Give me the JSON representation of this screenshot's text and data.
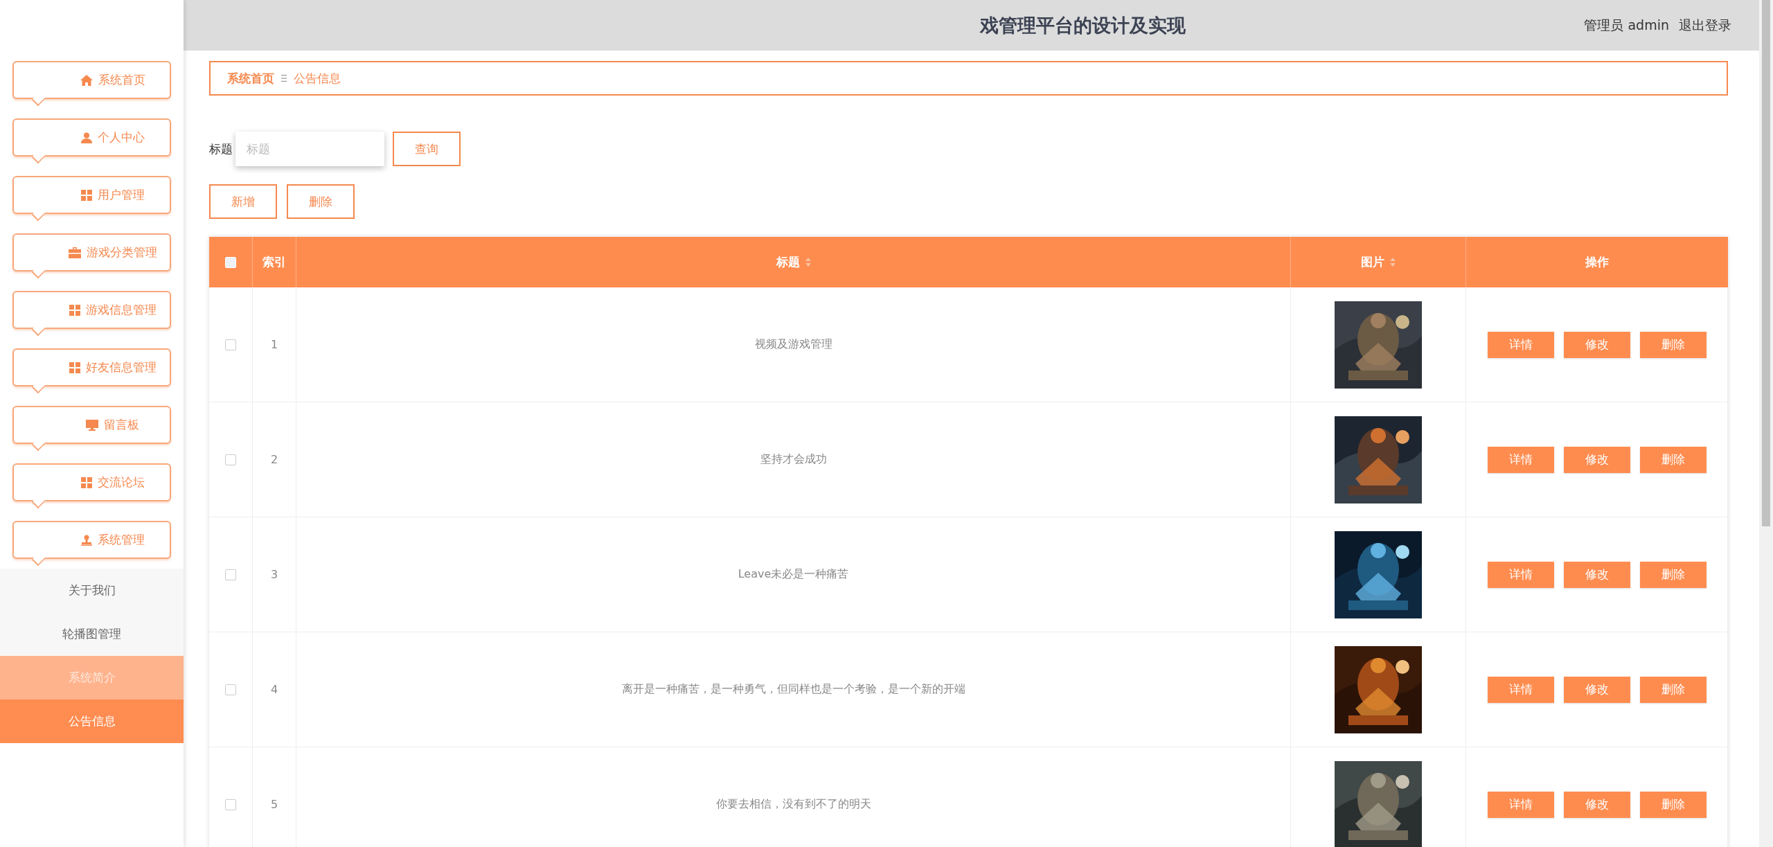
{
  "header": {
    "title": "戏管理平台的设计及实现",
    "user_label": "管理员 admin",
    "logout": "退出登录"
  },
  "sidebar": {
    "items": [
      {
        "label": "系统首页",
        "kind": "home"
      },
      {
        "label": "个人中心",
        "kind": "user"
      },
      {
        "label": "用户管理",
        "kind": "grid"
      },
      {
        "label": "游戏分类管理",
        "kind": "briefcase"
      },
      {
        "label": "游戏信息管理",
        "kind": "grid"
      },
      {
        "label": "好友信息管理",
        "kind": "grid"
      },
      {
        "label": "留言板",
        "kind": "monitor"
      },
      {
        "label": "交流论坛",
        "kind": "grid"
      },
      {
        "label": "系统管理",
        "kind": "stamp"
      }
    ],
    "submenu": [
      {
        "label": "关于我们",
        "selected": false,
        "hovered": false
      },
      {
        "label": "轮播图管理",
        "selected": false,
        "hovered": false
      },
      {
        "label": "系统简介",
        "selected": false,
        "hovered": true
      },
      {
        "label": "公告信息",
        "selected": true,
        "hovered": false
      }
    ]
  },
  "breadcrumb": [
    "系统首页",
    "公告信息"
  ],
  "search": {
    "label": "标题",
    "placeholder": "标题",
    "button": "查询"
  },
  "actions": [
    "新增",
    "删除"
  ],
  "table": {
    "header_checked": false,
    "columns": [
      {
        "label": "索引",
        "sortable": false
      },
      {
        "label": "标题",
        "sortable": true
      },
      {
        "label": "图片",
        "sortable": true
      },
      {
        "label": "操作",
        "sortable": false
      }
    ],
    "rows": [
      {
        "checked": false,
        "index": "1",
        "title": "视频及游戏管理",
        "buttons": [
          "详情",
          "修改",
          "删除"
        ]
      },
      {
        "checked": false,
        "index": "2",
        "title": "坚持才会成功",
        "buttons": [
          "详情",
          "修改",
          "删除"
        ]
      },
      {
        "checked": false,
        "index": "3",
        "title": "Leave未必是一种痛苦",
        "buttons": [
          "详情",
          "修改",
          "删除"
        ]
      },
      {
        "checked": false,
        "index": "4",
        "title": "离开是一种痛苦，是一种勇气，但同样也是一个考验，是一个新的开端",
        "buttons": [
          "详情",
          "修改",
          "删除"
        ]
      },
      {
        "checked": false,
        "index": "5",
        "title": "你要去相信，没有到不了的明天",
        "buttons": [
          "详情",
          "修改",
          "删除"
        ]
      }
    ]
  }
}
